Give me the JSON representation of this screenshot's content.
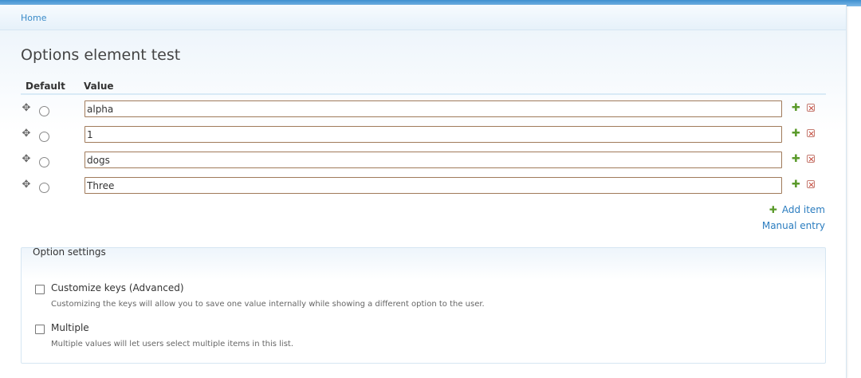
{
  "breadcrumb": {
    "home": "Home"
  },
  "page": {
    "title": "Options element test"
  },
  "table": {
    "headers": {
      "default": "Default",
      "value": "Value"
    },
    "rows": [
      {
        "value": "alpha"
      },
      {
        "value": "1"
      },
      {
        "value": "dogs"
      },
      {
        "value": "Three"
      }
    ],
    "add_item": "Add item",
    "manual_entry": "Manual entry"
  },
  "settings": {
    "legend": "Option settings",
    "customize_keys": {
      "label": "Customize keys (Advanced)",
      "description": "Customizing the keys will allow you to save one value internally while showing a different option to the user."
    },
    "multiple": {
      "label": "Multiple",
      "description": "Multiple values will let users select multiple items in this list."
    }
  },
  "colors": {
    "link": "#2a7cbf",
    "add_icon": "#5a9a2a",
    "remove_icon": "#c0392b"
  }
}
